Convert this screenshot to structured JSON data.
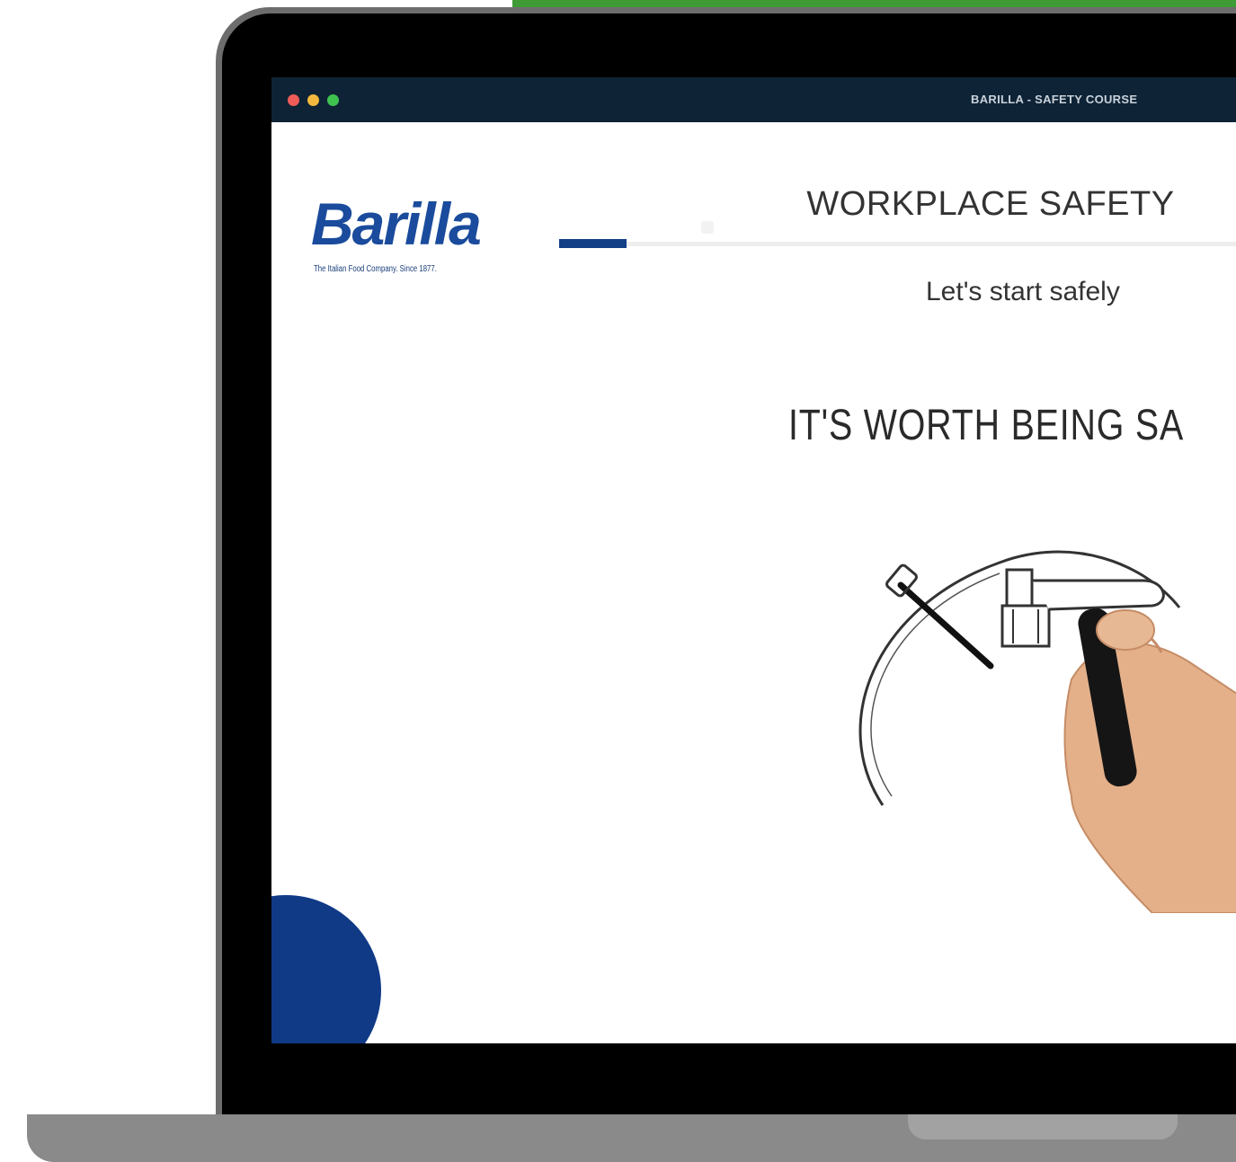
{
  "window": {
    "title": "BARILLA - SAFETY COURSE",
    "traffic_lights": [
      "#ef5b58",
      "#f3b93e",
      "#3fc24f"
    ]
  },
  "brand": {
    "logo_text": "Barilla",
    "tagline": "The Italian Food Company. Since 1877.",
    "color": "#1a4b9c"
  },
  "content": {
    "heading": "WORKPLACE SAFETY",
    "subheading": "Let's start safely",
    "slogan": "IT'S WORTH BEING SA"
  },
  "illustration": {
    "icon": "hand-drawing-safety-icon"
  },
  "menu": {
    "icon": "more-vertical-icon"
  },
  "colors": {
    "accent_green": "#3f9b35",
    "titlebar": "#0e2335",
    "menu_blue": "#103a86"
  }
}
